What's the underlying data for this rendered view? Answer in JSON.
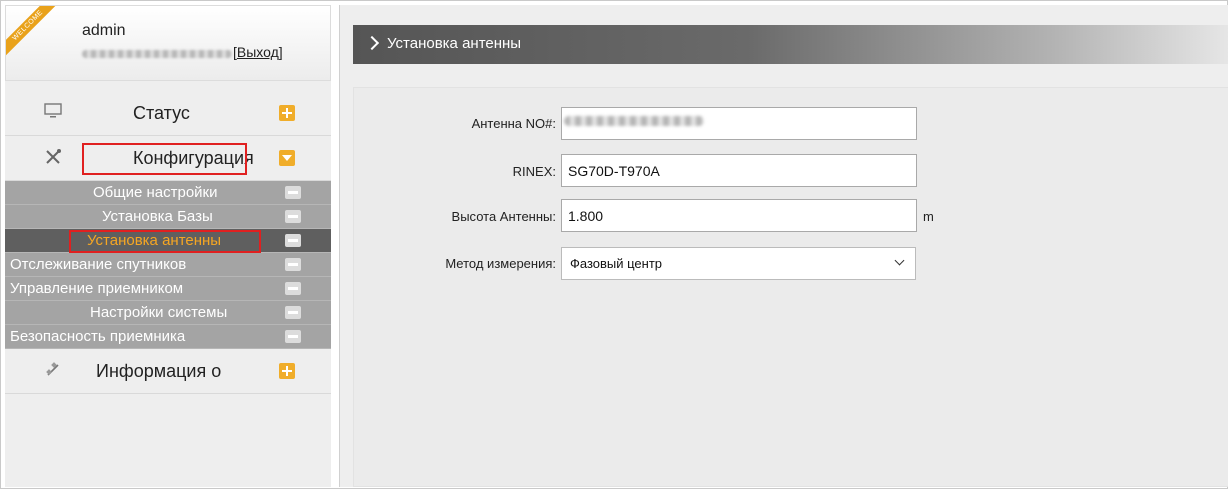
{
  "user": {
    "ribbon_text": "WELCOME",
    "name": "admin",
    "logout_open": "[",
    "logout_label": "Выход",
    "logout_close": "]"
  },
  "sidebar": {
    "status": {
      "label": "Статус",
      "icon": "monitor-icon"
    },
    "config": {
      "label": "Конфигурация",
      "icon": "tools-icon"
    },
    "submenu": [
      {
        "label": "Общие настройки"
      },
      {
        "label": "Установка Базы"
      },
      {
        "label": "Установка антенны",
        "active": true
      },
      {
        "label": "Отслеживание спутников"
      },
      {
        "label": "Управление приемником"
      },
      {
        "label": "Настройки системы"
      },
      {
        "label": "Безопасность приемника"
      }
    ],
    "info": {
      "label": "Информация о",
      "icon": "satellite-icon"
    }
  },
  "main": {
    "title": "Установка антенны",
    "form": {
      "antenna_no_label": "Антенна NO#:",
      "rinex_label": "RINEX:",
      "rinex_value": "SG70D-T970A",
      "height_label": "Высота Антенны:",
      "height_value": "1.800",
      "height_unit": "m",
      "method_label": "Метод измерения:",
      "method_value": "Фазовый центр"
    }
  },
  "colors": {
    "accent_orange": "#f0ad2a",
    "active_text": "#f5a623",
    "highlight_red": "#e02020"
  }
}
